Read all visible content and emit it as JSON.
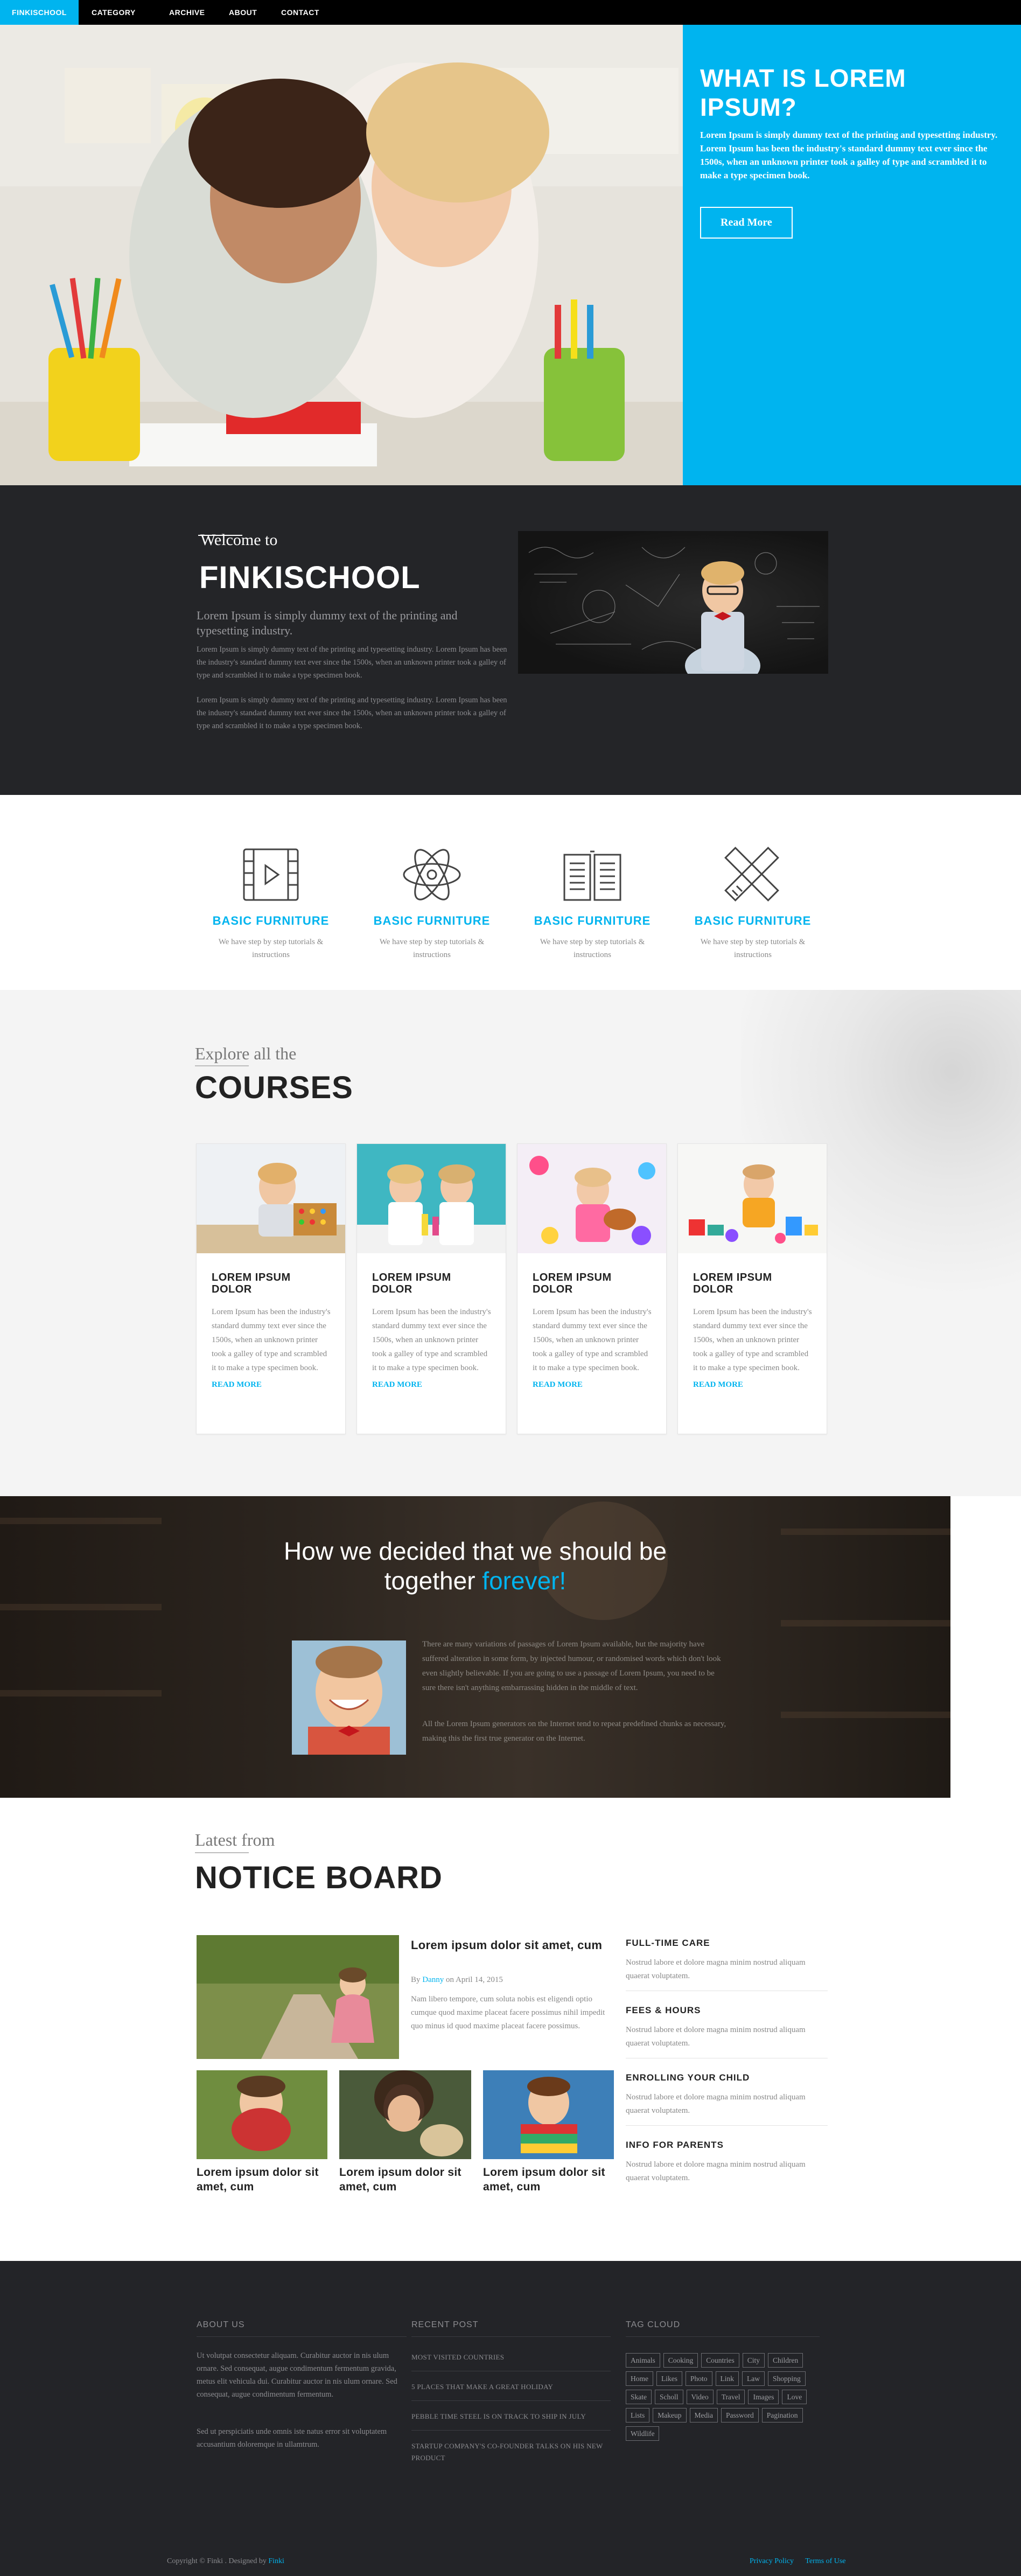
{
  "nav": {
    "brand": "FINKISCHOOL",
    "items": [
      "CATEGORY",
      "ARCHIVE",
      "ABOUT",
      "CONTACT"
    ]
  },
  "hero": {
    "title": "WHAT IS LOREM IPSUM?",
    "text": "Lorem Ipsum is simply dummy text of the printing and typesetting industry. Lorem Ipsum has been the industry's standard dummy text ever since the 1500s, when an unknown printer took a galley of type and scrambled it to make a type specimen book.",
    "button": "Read More"
  },
  "welcome": {
    "small": "Welcome to",
    "big": "FINKISCHOOL",
    "sub": "Lorem Ipsum is simply dummy text of the printing and typesetting industry.",
    "p1": "Lorem Ipsum is simply dummy text of the printing and typesetting industry. Lorem Ipsum has been the industry's standard dummy text ever since the 1500s, when an unknown printer took a galley of type and scrambled it to make a type specimen book.",
    "p2": "Lorem Ipsum is simply dummy text of the printing and typesetting industry. Lorem Ipsum has been the industry's standard dummy text ever since the 1500s, when an unknown printer took a galley of type and scrambled it to make a type specimen book."
  },
  "features": [
    {
      "icon": "video-icon",
      "title": "BASIC FURNITURE",
      "desc": "We have step by step tutorials & instructions"
    },
    {
      "icon": "atom-icon",
      "title": "BASIC FURNITURE",
      "desc": "We have step by step tutorials & instructions"
    },
    {
      "icon": "book-icon",
      "title": "BASIC FURNITURE",
      "desc": "We have step by step tutorials & instructions"
    },
    {
      "icon": "pencil-ruler-icon",
      "title": "BASIC FURNITURE",
      "desc": "We have step by step tutorials & instructions"
    }
  ],
  "courses": {
    "small": "Explore all the",
    "big": "COURSES",
    "cards": [
      {
        "title": "LOREM IPSUM DOLOR",
        "desc": "Lorem Ipsum has been the industry's standard dummy text ever since the 1500s, when an unknown printer took a galley of type and scrambled it to make a type specimen book.",
        "link": "READ MORE"
      },
      {
        "title": "LOREM IPSUM DOLOR",
        "desc": "Lorem Ipsum has been the industry's standard dummy text ever since the 1500s, when an unknown printer took a galley of type and scrambled it to make a type specimen book.",
        "link": "READ MORE"
      },
      {
        "title": "LOREM IPSUM DOLOR",
        "desc": "Lorem Ipsum has been the industry's standard dummy text ever since the 1500s, when an unknown printer took a galley of type and scrambled it to make a type specimen book.",
        "link": "READ MORE"
      },
      {
        "title": "LOREM IPSUM DOLOR",
        "desc": "Lorem Ipsum has been the industry's standard dummy text ever since the 1500s, when an unknown printer took a galley of type and scrambled it to make a type specimen book.",
        "link": "READ MORE"
      }
    ]
  },
  "testimonial": {
    "line1": "How we decided that we should be",
    "line2": "together",
    "accent": "forever!",
    "p1": "There are many variations of passages of Lorem Ipsum available, but the majority have suffered alteration in some form, by injected humour, or randomised words which don't look even slightly believable. If you are going to use a passage of Lorem Ipsum, you need to be sure there isn't anything embarrassing hidden in the middle of text.",
    "p2": "All the Lorem Ipsum generators on the Internet tend to repeat predefined chunks as necessary, making this the first true generator on the Internet."
  },
  "notice": {
    "small": "Latest from",
    "big": "NOTICE BOARD",
    "main": {
      "title": "Lorem ipsum dolor sit amet, cum",
      "by": "By",
      "author": "Danny",
      "date": "on April 14, 2015",
      "body": "Nam libero tempore, cum soluta nobis est eligendi optio cumque quod maxime placeat facere possimus nihil impedit quo minus id quod maxime placeat facere possimus."
    },
    "small_posts": [
      {
        "title": "Lorem ipsum dolor sit amet, cum"
      },
      {
        "title": "Lorem ipsum dolor sit amet, cum"
      },
      {
        "title": "Lorem ipsum dolor sit amet, cum"
      }
    ],
    "side": [
      {
        "title": "FULL-TIME CARE",
        "text": "Nostrud labore et dolore magna minim nostrud aliquam quaerat voluptatem."
      },
      {
        "title": "FEES & HOURS",
        "text": "Nostrud labore et dolore magna minim nostrud aliquam quaerat voluptatem."
      },
      {
        "title": "ENROLLING YOUR CHILD",
        "text": "Nostrud labore et dolore magna minim nostrud aliquam quaerat voluptatem."
      },
      {
        "title": "INFO FOR PARENTS",
        "text": "Nostrud labore et dolore magna minim nostrud aliquam quaerat voluptatem."
      }
    ]
  },
  "footer": {
    "about_title": "ABOUT US",
    "about_p1": "Ut volutpat consectetur aliquam. Curabitur auctor in nis ulum ornare. Sed consequat, augue condimentum fermentum gravida, metus elit vehicula dui. Curabitur auctor in nis ulum ornare. Sed consequat, augue condimentum fermentum.",
    "about_p2": "Sed ut perspiciatis unde omnis iste natus error sit voluptatem accusantium doloremque in ullamtrum.",
    "recent_title": "RECENT POST",
    "posts": [
      "MOST VISITED COUNTRIES",
      "5 PLACES THAT MAKE A GREAT HOLIDAY",
      "PEBBLE TIME STEEL IS ON TRACK TO SHIP IN JULY",
      "STARTUP COMPANY'S CO-FOUNDER TALKS ON HIS NEW PRODUCT"
    ],
    "tags_title": "TAG CLOUD",
    "tags": [
      "Animals",
      "Cooking",
      "Countries",
      "City",
      "Children",
      "Home",
      "Likes",
      "Photo",
      "Link",
      "Law",
      "Shopping",
      "Skate",
      "Scholl",
      "Video",
      "Travel",
      "Images",
      "Love",
      "Lists",
      "Makeup",
      "Media",
      "Password",
      "Pagination",
      "Wildlife"
    ],
    "copy_text": "Copyright © Finki . Designed by",
    "copy_link": "Finki",
    "privacy": "Privacy Policy",
    "terms": "Terms of Use"
  },
  "colors": {
    "accent": "#00b4ef",
    "dark": "#242528",
    "footer": "#232428"
  }
}
